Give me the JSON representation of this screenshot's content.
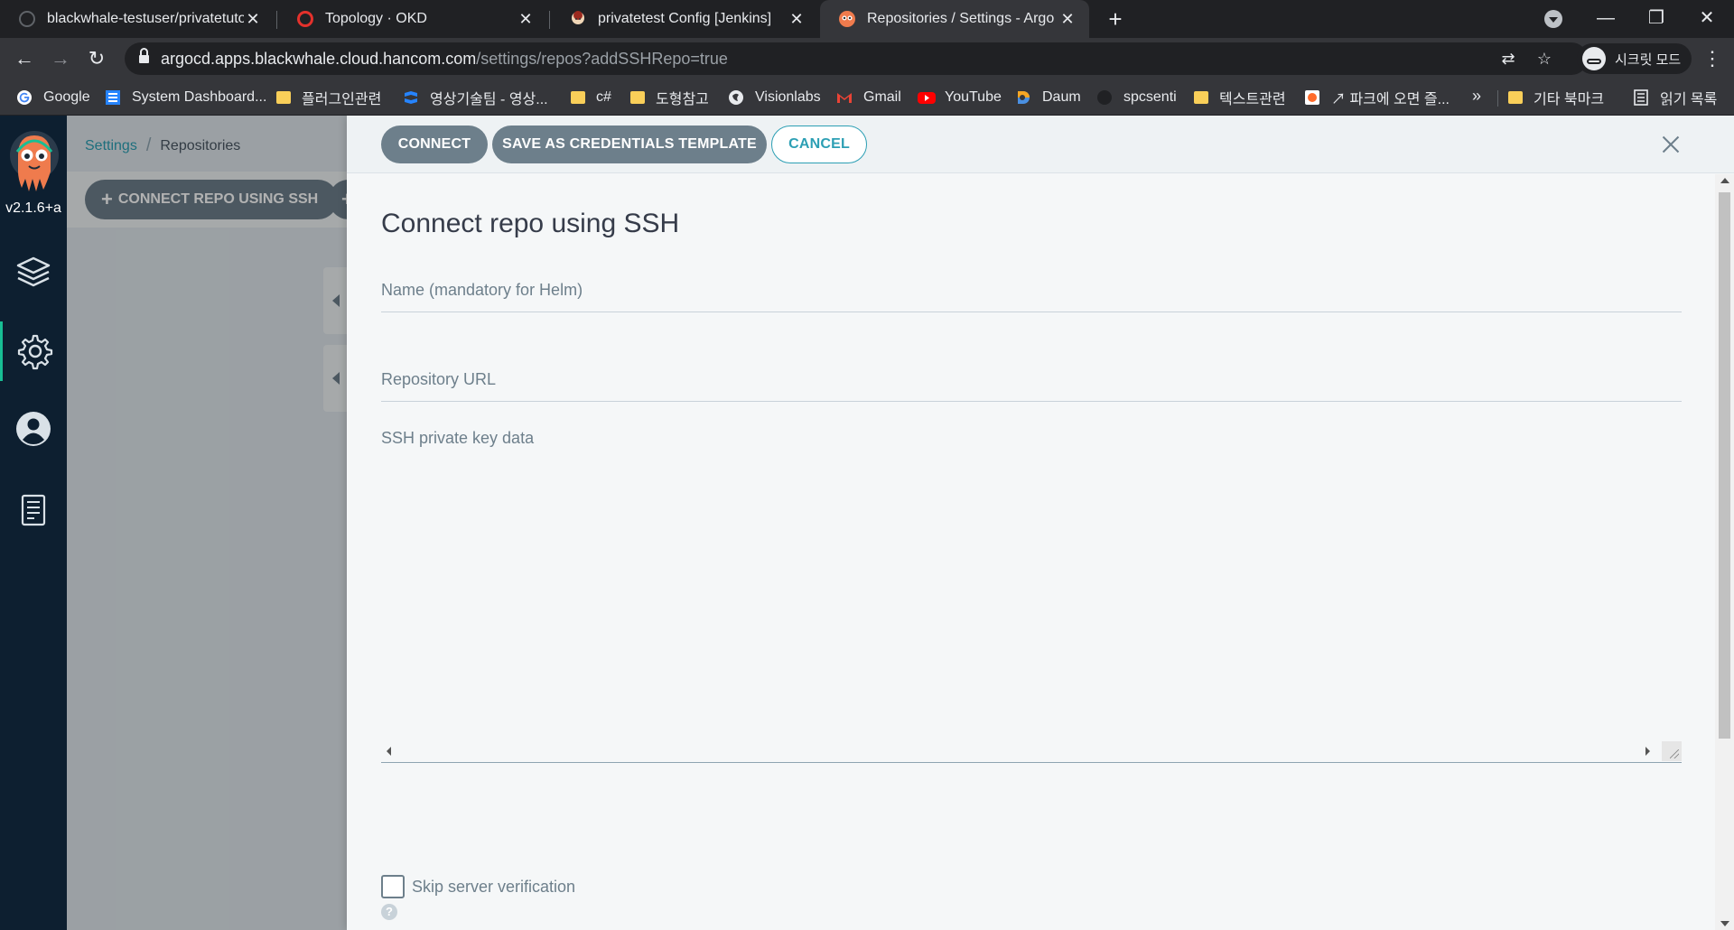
{
  "browser": {
    "tabs": [
      {
        "title": "blackwhale-testuser/privatetutor",
        "icon": "github-icon"
      },
      {
        "title": "Topology · OKD",
        "icon": "openshift-icon"
      },
      {
        "title": "privatetest Config [Jenkins]",
        "icon": "jenkins-icon"
      },
      {
        "title": "Repositories / Settings - Argo C",
        "icon": "argo-icon",
        "active": true
      }
    ],
    "url_host": "argocd.apps.blackwhale.cloud.hancom.com",
    "url_path": "/settings/repos?addSSHRepo=true",
    "profile_label": "시크릿 모드",
    "bookmarks": [
      {
        "label": "Google",
        "icon": "google-icon"
      },
      {
        "label": "System Dashboard...",
        "icon": "dashboard-icon"
      },
      {
        "label": "플러그인관련",
        "icon": "folder-icon"
      },
      {
        "label": "영상기술팀 - 영상...",
        "icon": "confluence-icon"
      },
      {
        "label": "c#",
        "icon": "folder-icon"
      },
      {
        "label": "도형참고",
        "icon": "folder-icon"
      },
      {
        "label": "Visionlabs",
        "icon": "globe-icon"
      },
      {
        "label": "Gmail",
        "icon": "gmail-icon"
      },
      {
        "label": "YouTube",
        "icon": "youtube-icon"
      },
      {
        "label": "Daum",
        "icon": "daum-icon"
      },
      {
        "label": "spcsenti",
        "icon": "github-icon"
      },
      {
        "label": "텍스트관련",
        "icon": "folder-icon"
      },
      {
        "label": "↗ 파크에 오면 즐...",
        "icon": "park-icon"
      }
    ],
    "bookmarks_more": "»",
    "other_bookmarks": "기타 북마크",
    "reading_list": "읽기 목록"
  },
  "app": {
    "version": "v2.1.6+a",
    "breadcrumb": {
      "parent": "Settings",
      "current": "Repositories"
    },
    "toolbar_button": "CONNECT REPO USING SSH",
    "panel": {
      "buttons": {
        "connect": "CONNECT",
        "save_template": "SAVE AS CREDENTIALS TEMPLATE",
        "cancel": "CANCEL"
      },
      "title": "Connect repo using SSH",
      "fields": {
        "name_label": "Name (mandatory for Helm)",
        "url_label": "Repository URL",
        "ssh_key_label": "SSH private key data"
      },
      "skip_verification_label": "Skip server verification",
      "help_glyph": "?"
    }
  },
  "colors": {
    "nav_bg": "#0d1f30",
    "accent": "#2c9fb4",
    "button_gray": "#6d7f8b",
    "active_nav": "#18be94"
  }
}
